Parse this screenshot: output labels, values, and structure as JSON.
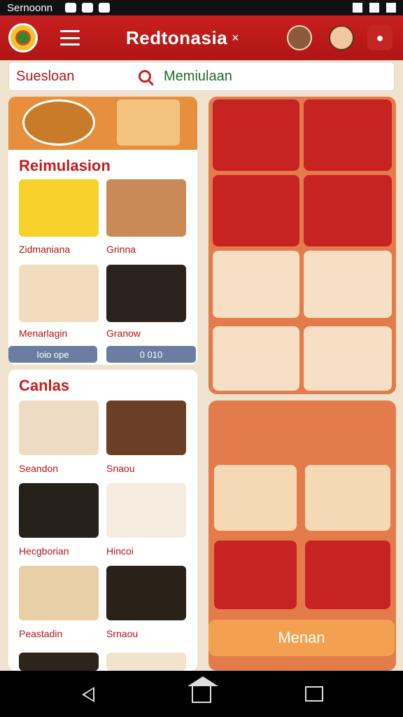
{
  "status_bar": {
    "left_text": "Sernoonn"
  },
  "header": {
    "title": "Redtonasia",
    "title_suffix": "×"
  },
  "search": {
    "left_label": "Suesloan",
    "right_label": "Memiulaan"
  },
  "left_card_1": {
    "title": "Reimulasion",
    "items": [
      "Zidmaniana",
      "Grinna",
      "Menarlagin",
      "Granow"
    ],
    "prices": [
      "Ioio ope",
      "0 010"
    ]
  },
  "left_card_2": {
    "title": "Canlas",
    "items": [
      "Seandon",
      "Snaou",
      "Hecgborian",
      "Hincoi",
      "Peastadin",
      "Srnaou"
    ]
  },
  "cta": {
    "label": "Menan"
  },
  "colors": {
    "primary": "#c81f1f",
    "accent": "#e37b4b",
    "cta": "#f3a151",
    "text_red": "#b41515",
    "text_green": "#1f6b2b"
  }
}
